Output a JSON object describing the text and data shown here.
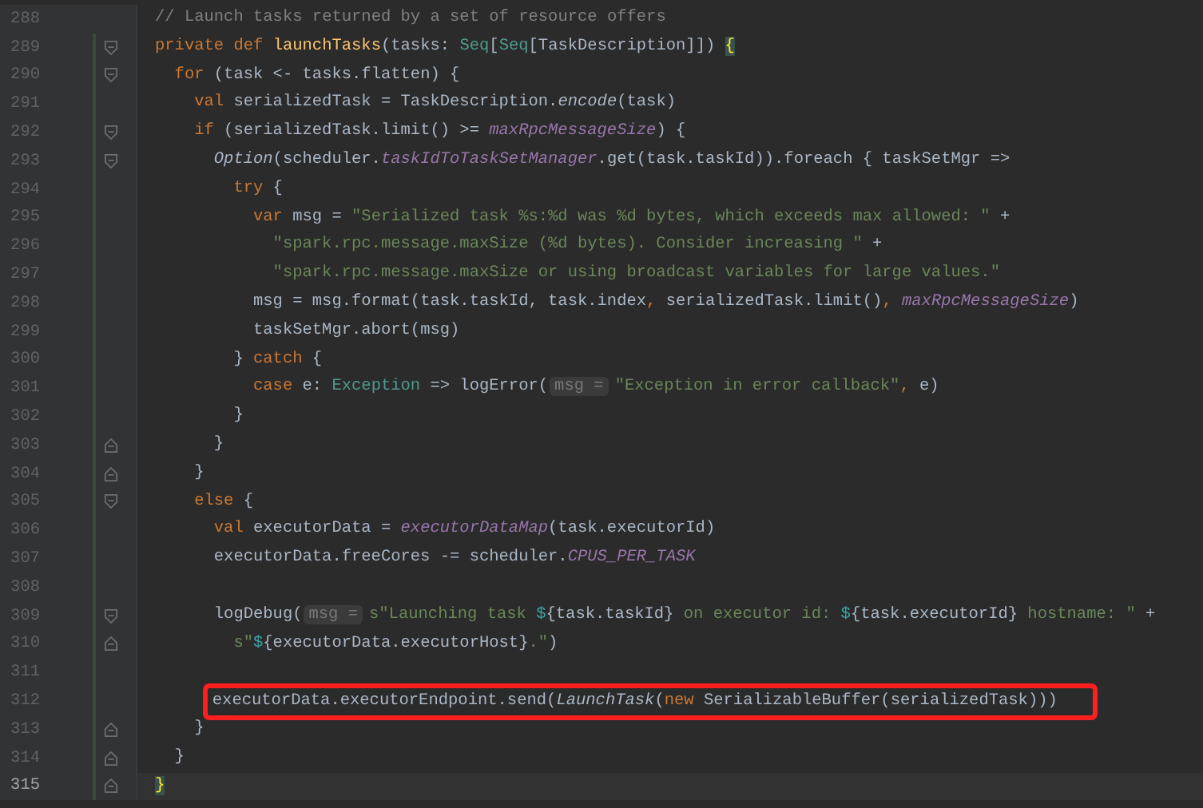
{
  "editor": {
    "lines": [
      {
        "number": "288",
        "fold_open": false,
        "fold_close": false,
        "changed": false,
        "current": false,
        "highlighted": false,
        "tokens": [
          {
            "kind": "comment",
            "text": "// Launch tasks returned by a set of resource offers"
          }
        ]
      },
      {
        "number": "289",
        "fold_open": true,
        "fold_close": false,
        "changed": true,
        "current": false,
        "highlighted": false,
        "tokens": [
          {
            "kind": "keyword",
            "text": "private def "
          },
          {
            "kind": "method",
            "text": "launchTasks"
          },
          {
            "kind": "plain",
            "text": "(tasks: "
          },
          {
            "kind": "type",
            "text": "Seq"
          },
          {
            "kind": "plain",
            "text": "["
          },
          {
            "kind": "type",
            "text": "Seq"
          },
          {
            "kind": "plain",
            "text": "[TaskDescription]]) "
          },
          {
            "kind": "brace-match",
            "text": "{"
          }
        ]
      },
      {
        "number": "290",
        "fold_open": true,
        "fold_close": false,
        "changed": true,
        "current": false,
        "highlighted": false,
        "tokens": [
          {
            "kind": "keyword",
            "text": "  for "
          },
          {
            "kind": "plain",
            "text": "(task <- tasks.flatten) {"
          }
        ]
      },
      {
        "number": "291",
        "fold_open": false,
        "fold_close": false,
        "changed": true,
        "current": false,
        "highlighted": false,
        "tokens": [
          {
            "kind": "keyword",
            "text": "    val "
          },
          {
            "kind": "plain",
            "text": "serializedTask = TaskDescription."
          },
          {
            "kind": "italic",
            "text": "encode"
          },
          {
            "kind": "plain",
            "text": "(task)"
          }
        ]
      },
      {
        "number": "292",
        "fold_open": true,
        "fold_close": false,
        "changed": true,
        "current": false,
        "highlighted": false,
        "tokens": [
          {
            "kind": "keyword",
            "text": "    if "
          },
          {
            "kind": "plain",
            "text": "(serializedTask.limit() >= "
          },
          {
            "kind": "field",
            "text": "maxRpcMessageSize"
          },
          {
            "kind": "plain",
            "text": ") {"
          }
        ]
      },
      {
        "number": "293",
        "fold_open": true,
        "fold_close": false,
        "changed": true,
        "current": false,
        "highlighted": false,
        "tokens": [
          {
            "kind": "italic",
            "text": "      Option"
          },
          {
            "kind": "plain",
            "text": "(scheduler."
          },
          {
            "kind": "field",
            "text": "taskIdToTaskSetManager"
          },
          {
            "kind": "plain",
            "text": ".get(task.taskId)).foreach { taskSetMgr =>"
          }
        ]
      },
      {
        "number": "294",
        "fold_open": false,
        "fold_close": false,
        "changed": true,
        "current": false,
        "highlighted": false,
        "tokens": [
          {
            "kind": "keyword",
            "text": "        try "
          },
          {
            "kind": "plain",
            "text": "{"
          }
        ]
      },
      {
        "number": "295",
        "fold_open": false,
        "fold_close": false,
        "changed": true,
        "current": false,
        "highlighted": false,
        "tokens": [
          {
            "kind": "keyword",
            "text": "          var "
          },
          {
            "kind": "plain",
            "text": "msg = "
          },
          {
            "kind": "string",
            "text": "\"Serialized task %s:%d was %d bytes, which exceeds max allowed: \""
          },
          {
            "kind": "plain",
            "text": " +"
          }
        ]
      },
      {
        "number": "296",
        "fold_open": false,
        "fold_close": false,
        "changed": true,
        "current": false,
        "highlighted": false,
        "tokens": [
          {
            "kind": "string",
            "text": "            \"spark.rpc.message.maxSize (%d bytes). Consider increasing \""
          },
          {
            "kind": "plain",
            "text": " +"
          }
        ]
      },
      {
        "number": "297",
        "fold_open": false,
        "fold_close": false,
        "changed": true,
        "current": false,
        "highlighted": false,
        "tokens": [
          {
            "kind": "string",
            "text": "            \"spark.rpc.message.maxSize or using broadcast variables for large values.\""
          }
        ]
      },
      {
        "number": "298",
        "fold_open": false,
        "fold_close": false,
        "changed": true,
        "current": false,
        "highlighted": false,
        "tokens": [
          {
            "kind": "plain",
            "text": "          msg = msg.format(task.taskId, task.index"
          },
          {
            "kind": "keyword",
            "text": ", "
          },
          {
            "kind": "plain",
            "text": "serializedTask.limit()"
          },
          {
            "kind": "keyword",
            "text": ", "
          },
          {
            "kind": "field",
            "text": "maxRpcMessageSize"
          },
          {
            "kind": "plain",
            "text": ")"
          }
        ]
      },
      {
        "number": "299",
        "fold_open": false,
        "fold_close": false,
        "changed": true,
        "current": false,
        "highlighted": false,
        "tokens": [
          {
            "kind": "plain",
            "text": "          taskSetMgr.abort(msg)"
          }
        ]
      },
      {
        "number": "300",
        "fold_open": false,
        "fold_close": false,
        "changed": true,
        "current": false,
        "highlighted": false,
        "tokens": [
          {
            "kind": "plain",
            "text": "        } "
          },
          {
            "kind": "keyword",
            "text": "catch "
          },
          {
            "kind": "plain",
            "text": "{"
          }
        ]
      },
      {
        "number": "301",
        "fold_open": false,
        "fold_close": false,
        "changed": true,
        "current": false,
        "highlighted": false,
        "tokens": [
          {
            "kind": "keyword",
            "text": "          case "
          },
          {
            "kind": "plain",
            "text": "e: "
          },
          {
            "kind": "type",
            "text": "Exception"
          },
          {
            "kind": "plain",
            "text": " => logError("
          },
          {
            "kind": "hint",
            "text": "msg ="
          },
          {
            "kind": "string",
            "text": "\"Exception in error callback\""
          },
          {
            "kind": "keyword",
            "text": ", "
          },
          {
            "kind": "plain",
            "text": "e)"
          }
        ]
      },
      {
        "number": "302",
        "fold_open": false,
        "fold_close": false,
        "changed": true,
        "current": false,
        "highlighted": false,
        "tokens": [
          {
            "kind": "plain",
            "text": "        }"
          }
        ]
      },
      {
        "number": "303",
        "fold_open": false,
        "fold_close": true,
        "changed": true,
        "current": false,
        "highlighted": false,
        "tokens": [
          {
            "kind": "plain",
            "text": "      }"
          }
        ]
      },
      {
        "number": "304",
        "fold_open": false,
        "fold_close": true,
        "changed": true,
        "current": false,
        "highlighted": false,
        "tokens": [
          {
            "kind": "plain",
            "text": "    }"
          }
        ]
      },
      {
        "number": "305",
        "fold_open": true,
        "fold_close": false,
        "changed": true,
        "current": false,
        "highlighted": false,
        "tokens": [
          {
            "kind": "keyword",
            "text": "    else "
          },
          {
            "kind": "plain",
            "text": "{"
          }
        ]
      },
      {
        "number": "306",
        "fold_open": false,
        "fold_close": false,
        "changed": true,
        "current": false,
        "highlighted": false,
        "tokens": [
          {
            "kind": "keyword",
            "text": "      val "
          },
          {
            "kind": "plain",
            "text": "executorData = "
          },
          {
            "kind": "field",
            "text": "executorDataMap"
          },
          {
            "kind": "plain",
            "text": "(task.executorId)"
          }
        ]
      },
      {
        "number": "307",
        "fold_open": false,
        "fold_close": false,
        "changed": true,
        "current": false,
        "highlighted": false,
        "tokens": [
          {
            "kind": "plain",
            "text": "      executorData.freeCores -= scheduler."
          },
          {
            "kind": "field",
            "text": "CPUS_PER_TASK"
          }
        ]
      },
      {
        "number": "308",
        "fold_open": false,
        "fold_close": false,
        "changed": true,
        "current": false,
        "highlighted": false
      },
      {
        "number": "309",
        "fold_open": true,
        "fold_close": false,
        "changed": true,
        "current": false,
        "highlighted": false,
        "tokens": [
          {
            "kind": "plain",
            "text": "      logDebug("
          },
          {
            "kind": "hint",
            "text": "msg ="
          },
          {
            "kind": "string",
            "text": "s\"Launching task "
          },
          {
            "kind": "interp",
            "text": "$"
          },
          {
            "kind": "plain",
            "text": "{task.taskId}"
          },
          {
            "kind": "string",
            "text": " on executor id: "
          },
          {
            "kind": "interp",
            "text": "$"
          },
          {
            "kind": "plain",
            "text": "{task.executorId}"
          },
          {
            "kind": "string",
            "text": " hostname: \""
          },
          {
            "kind": "plain",
            "text": " +"
          }
        ]
      },
      {
        "number": "310",
        "fold_open": false,
        "fold_close": true,
        "changed": true,
        "current": false,
        "highlighted": false,
        "tokens": [
          {
            "kind": "string",
            "text": "        s\""
          },
          {
            "kind": "interp",
            "text": "$"
          },
          {
            "kind": "plain",
            "text": "{executorData.executorHost}"
          },
          {
            "kind": "string",
            "text": ".\""
          },
          {
            "kind": "plain",
            "text": ")"
          }
        ]
      },
      {
        "number": "311",
        "fold_open": false,
        "fold_close": false,
        "changed": true,
        "current": false,
        "highlighted": false
      },
      {
        "number": "312",
        "fold_open": false,
        "fold_close": false,
        "changed": true,
        "current": false,
        "highlighted": true,
        "tokens": [
          {
            "kind": "plain",
            "text": "      executorData.executorEndpoint.send("
          },
          {
            "kind": "italic",
            "text": "LaunchTask"
          },
          {
            "kind": "plain",
            "text": "("
          },
          {
            "kind": "keyword",
            "text": "new "
          },
          {
            "kind": "plain",
            "text": "SerializableBuffer(serializedTask)))"
          }
        ]
      },
      {
        "number": "313",
        "fold_open": false,
        "fold_close": true,
        "changed": true,
        "current": false,
        "highlighted": false,
        "tokens": [
          {
            "kind": "plain",
            "text": "    }"
          }
        ]
      },
      {
        "number": "314",
        "fold_open": false,
        "fold_close": true,
        "changed": true,
        "current": false,
        "highlighted": false,
        "tokens": [
          {
            "kind": "plain",
            "text": "  }"
          }
        ]
      },
      {
        "number": "315",
        "fold_open": false,
        "fold_close": true,
        "changed": true,
        "current": true,
        "highlighted": false,
        "tokens": [
          {
            "kind": "brace-match",
            "text": "}"
          }
        ]
      }
    ]
  }
}
